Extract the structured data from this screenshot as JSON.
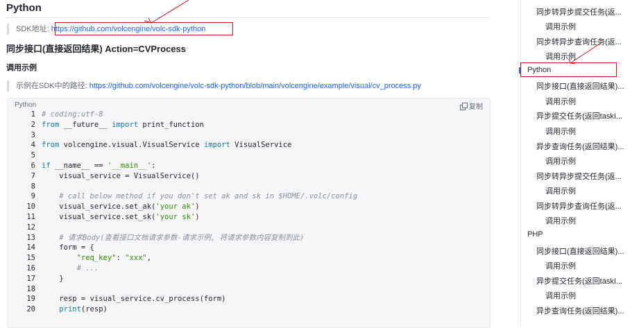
{
  "main": {
    "heading": "Python",
    "sdk_label": "SDK地址:",
    "sdk_link": "https://github.com/volcengine/volc-sdk-python",
    "section_title": "同步接口(直接返回结果) Action=CVProcess",
    "example_heading": "调用示例",
    "example_path_label": "示例在SDK中的路径:",
    "example_path_link": "https://github.com/volcengine/volc-sdk-python/blob/main/volcengine/example/visual/cv_process.py",
    "code": {
      "language": "Python",
      "copy_label": "复制",
      "lines": [
        {
          "n": "1",
          "segs": [
            {
              "t": "# coding:utf-8",
              "c": "c"
            }
          ]
        },
        {
          "n": "2",
          "segs": [
            {
              "t": "from",
              "c": "k"
            },
            {
              "t": " __future__ ",
              "c": "txt"
            },
            {
              "t": "import",
              "c": "k"
            },
            {
              "t": " print_function",
              "c": "txt"
            }
          ]
        },
        {
          "n": "3",
          "segs": []
        },
        {
          "n": "4",
          "segs": [
            {
              "t": "from",
              "c": "k"
            },
            {
              "t": " volcengine.visual.VisualService ",
              "c": "txt"
            },
            {
              "t": "import",
              "c": "k"
            },
            {
              "t": " VisualService",
              "c": "txt"
            }
          ]
        },
        {
          "n": "5",
          "segs": []
        },
        {
          "n": "6",
          "segs": [
            {
              "t": "if",
              "c": "k"
            },
            {
              "t": " __name__ == ",
              "c": "txt"
            },
            {
              "t": "'__main__'",
              "c": "s"
            },
            {
              "t": ":",
              "c": "txt"
            }
          ]
        },
        {
          "n": "7",
          "segs": [
            {
              "t": "    visual_service = VisualService()",
              "c": "txt"
            }
          ]
        },
        {
          "n": "8",
          "segs": []
        },
        {
          "n": "9",
          "segs": [
            {
              "t": "    # call below method if you don't set ak and sk in $HOME/.volc/config",
              "c": "c"
            }
          ]
        },
        {
          "n": "10",
          "segs": [
            {
              "t": "    visual_service.set_ak(",
              "c": "txt"
            },
            {
              "t": "'your ak'",
              "c": "s"
            },
            {
              "t": ")",
              "c": "txt"
            }
          ]
        },
        {
          "n": "11",
          "segs": [
            {
              "t": "    visual_service.set_sk(",
              "c": "txt"
            },
            {
              "t": "'your sk'",
              "c": "s"
            },
            {
              "t": ")",
              "c": "txt"
            }
          ]
        },
        {
          "n": "12",
          "segs": []
        },
        {
          "n": "13",
          "segs": [
            {
              "t": "    # 请求Body(查看接口文档请求参数-请求示例, 将请求参数内容复制到此)",
              "c": "c"
            }
          ]
        },
        {
          "n": "14",
          "segs": [
            {
              "t": "    form = {",
              "c": "txt"
            }
          ]
        },
        {
          "n": "15",
          "segs": [
            {
              "t": "        ",
              "c": "txt"
            },
            {
              "t": "\"req_key\"",
              "c": "s"
            },
            {
              "t": ": ",
              "c": "txt"
            },
            {
              "t": "\"xxx\"",
              "c": "s"
            },
            {
              "t": ",",
              "c": "txt"
            }
          ]
        },
        {
          "n": "16",
          "segs": [
            {
              "t": "        # ...",
              "c": "c"
            }
          ]
        },
        {
          "n": "17",
          "segs": [
            {
              "t": "    }",
              "c": "txt"
            }
          ]
        },
        {
          "n": "18",
          "segs": []
        },
        {
          "n": "19",
          "segs": [
            {
              "t": "    resp = visual_service.cv_process(form)",
              "c": "txt"
            }
          ]
        },
        {
          "n": "20",
          "segs": [
            {
              "t": "    ",
              "c": "txt"
            },
            {
              "t": "print",
              "c": "k"
            },
            {
              "t": "(resp)",
              "c": "txt"
            }
          ]
        }
      ]
    }
  },
  "toc": {
    "items": [
      {
        "label": "同步转异步提交任务(返...",
        "level": 2
      },
      {
        "label": "调用示例",
        "level": 3
      },
      {
        "label": "同步转异步查询任务(返...",
        "level": 2
      },
      {
        "label": "调用示例",
        "level": 3
      },
      {
        "label": "Python",
        "level": 1,
        "active": true
      },
      {
        "label": "同步接口(直接返回结果)...",
        "level": 2
      },
      {
        "label": "调用示例",
        "level": 3
      },
      {
        "label": "异步提交任务(返回taskI...",
        "level": 2
      },
      {
        "label": "调用示例",
        "level": 3
      },
      {
        "label": "异步查询任务(返回结果)...",
        "level": 2
      },
      {
        "label": "调用示例",
        "level": 3
      },
      {
        "label": "同步转异步提交任务(返...",
        "level": 2
      },
      {
        "label": "调用示例",
        "level": 3
      },
      {
        "label": "同步转异步查询任务(返...",
        "level": 2
      },
      {
        "label": "调用示例",
        "level": 3
      },
      {
        "label": "PHP",
        "level": 1
      },
      {
        "label": "同步接口(直接返回结果)...",
        "level": 2
      },
      {
        "label": "调用示例",
        "level": 3
      },
      {
        "label": "异步提交任务(返回taskI...",
        "level": 2
      },
      {
        "label": "调用示例",
        "level": 3
      },
      {
        "label": "异步查询任务(返回结果)...",
        "level": 2
      }
    ]
  },
  "colors": {
    "link": "#1664ff",
    "annotation": "#c4161c",
    "code_bg": "#f5f6f7"
  }
}
